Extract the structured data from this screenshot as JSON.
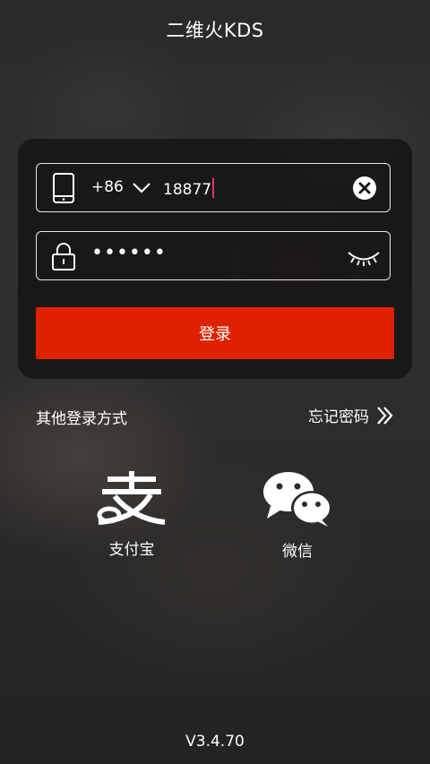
{
  "header": {
    "title": "二维火KDS"
  },
  "login_form": {
    "phone": {
      "icon": "mobile-phone-icon",
      "country_code": "+86",
      "value": "18877",
      "clear_icon": "clear-circle-x-icon"
    },
    "password": {
      "icon": "lock-icon",
      "value": "••••••",
      "toggle_icon": "eye-closed-icon"
    },
    "submit_label": "登录"
  },
  "options": {
    "other_login_label": "其他登录方式",
    "forgot_password_label": "忘记密码",
    "forgot_icon": "double-chevron-right-icon"
  },
  "social_login": [
    {
      "label": "支付宝",
      "icon": "alipay-logo-icon"
    },
    {
      "label": "微信",
      "icon": "wechat-logo-icon"
    }
  ],
  "footer": {
    "version": "V3.4.70"
  },
  "colors": {
    "primary_button": "#e02100",
    "cursor": "#e0336f",
    "text": "#ffffff"
  }
}
